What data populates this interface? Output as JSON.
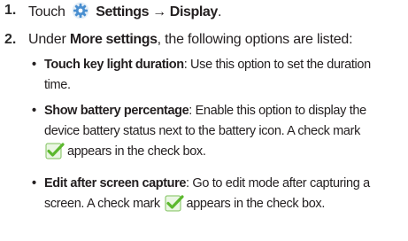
{
  "steps": [
    {
      "number": "1.",
      "prefix": "Touch",
      "icon": "settings-gear-icon",
      "bold": "Settings → Display",
      "suffix": "."
    },
    {
      "number": "2.",
      "prefix": "Under",
      "bold": "More settings",
      "suffix": ", the following options are listed:"
    }
  ],
  "bullets": [
    {
      "title": "Touch key light duration",
      "lines": [
        ": Use this option to set the duration",
        "time."
      ]
    },
    {
      "title": "Show battery percentage",
      "lines": [
        ": Enable this option to display the",
        "device battery status next to the battery icon. A check mark",
        "appears in the check box."
      ]
    },
    {
      "title": "Edit after screen capture",
      "lines": [
        ": Go to edit mode after capturing a",
        "screen. A check mark",
        "appears in the check box."
      ]
    }
  ],
  "icons": {
    "gear": "settings-gear-icon",
    "check": "checkbox-checkmark-icon"
  },
  "colors": {
    "gear_blue": "#4a8fd0",
    "check_green": "#5cb82e"
  }
}
